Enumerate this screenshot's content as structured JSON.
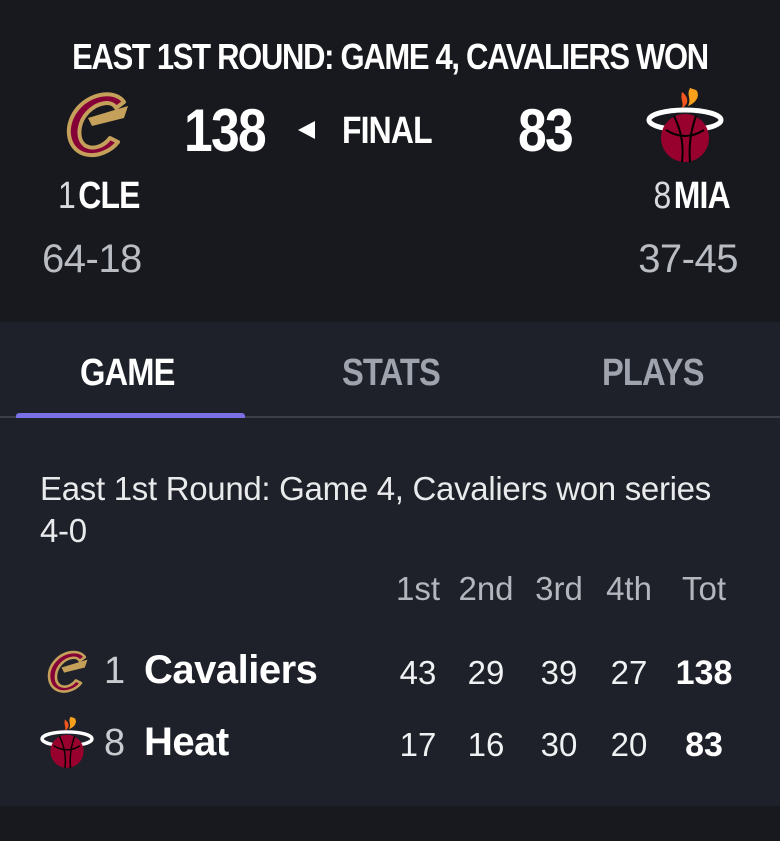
{
  "header": {
    "series_title": "EAST 1ST ROUND: GAME 4, CAVALIERS WON",
    "status": "FINAL",
    "home": {
      "seed": "1",
      "abbr": "CLE",
      "score": "138",
      "record": "64-18",
      "logo_icon": "cavaliers-logo-icon"
    },
    "away": {
      "seed": "8",
      "abbr": "MIA",
      "score": "83",
      "record": "37-45",
      "logo_icon": "heat-logo-icon"
    }
  },
  "tabs": [
    {
      "label": "GAME",
      "active": true
    },
    {
      "label": "STATS",
      "active": false
    },
    {
      "label": "PLAYS",
      "active": false
    }
  ],
  "summary": "East 1st Round: Game 4, Cavaliers won series 4-0",
  "linescore": {
    "columns": [
      "1st",
      "2nd",
      "3rd",
      "4th",
      "Tot"
    ],
    "rows": [
      {
        "seed": "1",
        "team": "Cavaliers",
        "values": [
          "43",
          "29",
          "39",
          "27",
          "138"
        ]
      },
      {
        "seed": "8",
        "team": "Heat",
        "values": [
          "17",
          "16",
          "30",
          "20",
          "83"
        ]
      }
    ]
  },
  "colors": {
    "accent": "#7b6fe5",
    "header_bg": "#17191e",
    "body_bg": "#1e2129",
    "cavaliers_wine": "#860038",
    "cavaliers_gold": "#c4a05a",
    "heat_red": "#98002e"
  }
}
